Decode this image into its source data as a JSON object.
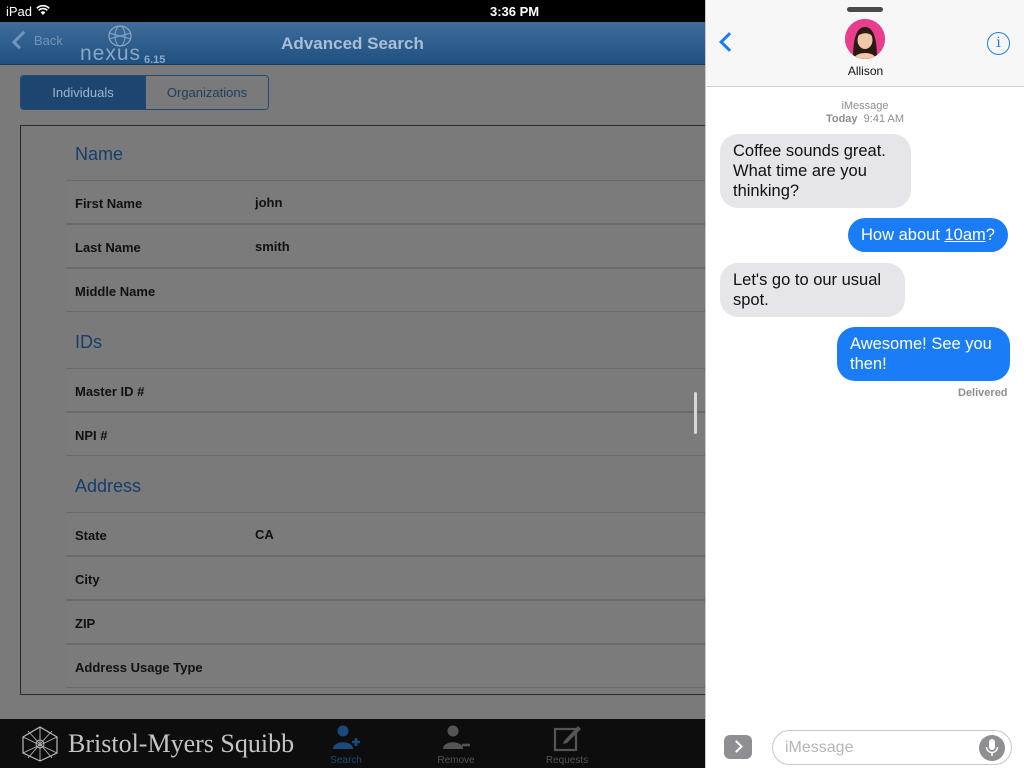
{
  "statusbar": {
    "device": "iPad",
    "time": "3:36 PM"
  },
  "nexus": {
    "nav": {
      "back_label": "Back",
      "logo_text": "nexus",
      "version": "6.15",
      "title": "Advanced Search"
    },
    "segments": [
      "Individuals",
      "Organizations"
    ],
    "selected_segment": "Individuals",
    "sections": {
      "name": {
        "title": "Name",
        "fields": [
          {
            "label": "First Name",
            "value": "john"
          },
          {
            "label": "Last Name",
            "value": "smith"
          },
          {
            "label": "Middle Name",
            "value": ""
          }
        ]
      },
      "ids": {
        "title": "IDs",
        "fields": [
          {
            "label": "Master ID #",
            "value": ""
          },
          {
            "label": "NPI #",
            "value": ""
          }
        ]
      },
      "address": {
        "title": "Address",
        "fields": [
          {
            "label": "State",
            "value": "CA"
          },
          {
            "label": "City",
            "value": ""
          },
          {
            "label": "ZIP",
            "value": ""
          },
          {
            "label": "Address Usage Type",
            "value": ""
          }
        ]
      }
    },
    "brand": "Bristol-Myers Squibb",
    "tabs": [
      {
        "label": "Search",
        "icon": "person-add-icon",
        "active": true
      },
      {
        "label": "Remove",
        "icon": "person-remove-icon",
        "active": false
      },
      {
        "label": "Requests",
        "icon": "compose-icon",
        "active": false
      }
    ]
  },
  "messages": {
    "contact_name": "Allison",
    "service_label": "iMessage",
    "date_label": "Today",
    "time_label": "9:41 AM",
    "thread": [
      {
        "direction": "incoming",
        "text": "Coffee sounds great. What time are you thinking?"
      },
      {
        "direction": "outgoing",
        "text_before": "How about ",
        "link": "10am",
        "text_after": "?"
      },
      {
        "direction": "incoming",
        "text": "Let's go to our usual spot."
      },
      {
        "direction": "outgoing",
        "text": "Awesome! See you then!"
      }
    ],
    "status": "Delivered",
    "input_placeholder": "iMessage",
    "colors": {
      "outgoing": "#1a7cf6",
      "incoming": "#e5e5ea"
    }
  }
}
